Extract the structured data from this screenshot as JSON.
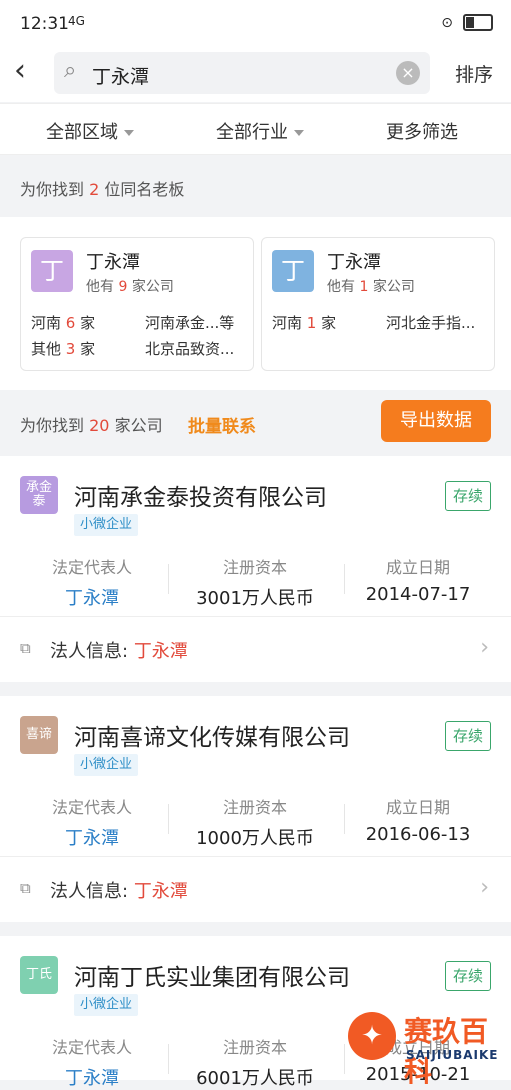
{
  "status_bar": {
    "time": "12:31",
    "signal": "4G",
    "wifi_icon": "wifi-icon"
  },
  "search": {
    "query": "丁永潭",
    "sort_label": "排序"
  },
  "filters": [
    {
      "label": "全部区域"
    },
    {
      "label": "全部行业"
    },
    {
      "label": "更多筛选"
    }
  ],
  "boss_summary": {
    "prefix": "为你找到",
    "count": "2",
    "suffix": "位同名老板"
  },
  "bosses": [
    {
      "avatar_char": "丁",
      "avatar_color": "#c8a6e3",
      "name": "丁永潭",
      "sub_prefix": "他有",
      "count": "9",
      "sub_suffix": "家公司",
      "line1_region": "河南",
      "line1_count": "6",
      "line1_unit": "家",
      "line1_company": "河南承金...等",
      "line2_region": "其他",
      "line2_count": "3",
      "line2_unit": "家",
      "line2_company": "北京品致资..."
    },
    {
      "avatar_char": "丁",
      "avatar_color": "#7fb3e0",
      "name": "丁永潭",
      "sub_prefix": "他有",
      "count": "1",
      "sub_suffix": "家公司",
      "line1_region": "河南",
      "line1_count": "1",
      "line1_unit": "家",
      "line1_company": "河北金手指..."
    }
  ],
  "company_summary": {
    "prefix": "为你找到",
    "count": "20",
    "suffix": "家公司",
    "batch_label": "批量联系",
    "export_label": "导出数据"
  },
  "companies": [
    {
      "logo_text": "承金泰",
      "logo_color": "#b79be0",
      "name": "河南承金泰投资有限公司",
      "status": "存续",
      "tag": "小微企业",
      "rep_label": "法定代表人",
      "rep": "丁永潭",
      "capital_label": "注册资本",
      "capital": "3001万人民币",
      "date_label": "成立日期",
      "date": "2014-07-17",
      "legal_label": "法人信息:",
      "legal_value": "丁永潭"
    },
    {
      "logo_text": "喜谛",
      "logo_color": "#c9a48e",
      "name": "河南喜谛文化传媒有限公司",
      "status": "存续",
      "tag": "小微企业",
      "rep_label": "法定代表人",
      "rep": "丁永潭",
      "capital_label": "注册资本",
      "capital": "1000万人民币",
      "date_label": "成立日期",
      "date": "2016-06-13",
      "legal_label": "法人信息:",
      "legal_value": "丁永潭"
    },
    {
      "logo_text": "丁氏",
      "logo_color": "#7fd0b0",
      "name": "河南丁氏实业集团有限公司",
      "status": "存续",
      "tag": "小微企业",
      "rep_label": "法定代表人",
      "rep": "丁永潭",
      "capital_label": "注册资本",
      "capital": "6001万人民币",
      "date_label": "成立日期",
      "date": "2015-10-21"
    }
  ],
  "watermark": {
    "cn": "赛玖百科",
    "en": "SAIJIUBAIKE"
  }
}
